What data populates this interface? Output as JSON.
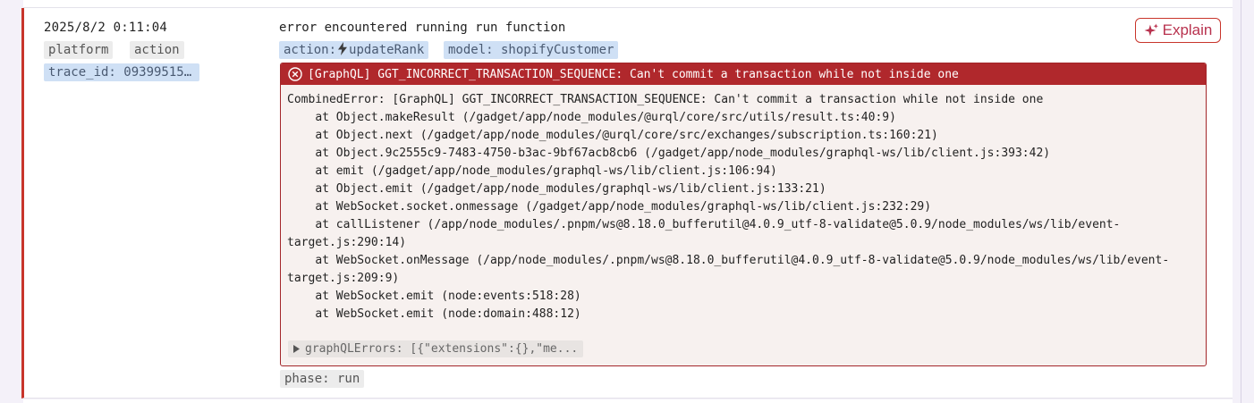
{
  "log": {
    "timestamp": "2025/8/2 0:11:04",
    "tags": [
      "platform",
      "action"
    ],
    "trace_id": "trace_id: 09399515…",
    "message": "error encountered running run function",
    "action_prefix": "action:",
    "action_name": "updateRank",
    "model": "model: shopifyCustomer",
    "explain_label": "Explain",
    "error_title": "[GraphQL] GGT_INCORRECT_TRANSACTION_SEQUENCE: Can't commit a transaction while not inside one",
    "stack": [
      "CombinedError: [GraphQL] GGT_INCORRECT_TRANSACTION_SEQUENCE: Can't commit a transaction while not inside one",
      "    at Object.makeResult (/gadget/app/node_modules/@urql/core/src/utils/result.ts:40:9)",
      "    at Object.next (/gadget/app/node_modules/@urql/core/src/exchanges/subscription.ts:160:21)",
      "    at Object.9c2555c9-7483-4750-b3ac-9bf67acb8cb6 (/gadget/app/node_modules/graphql-ws/lib/client.js:393:42)",
      "    at emit (/gadget/app/node_modules/graphql-ws/lib/client.js:106:94)",
      "    at Object.emit (/gadget/app/node_modules/graphql-ws/lib/client.js:133:21)",
      "    at WebSocket.socket.onmessage (/gadget/app/node_modules/graphql-ws/lib/client.js:232:29)",
      "    at callListener (/app/node_modules/.pnpm/ws@8.18.0_bufferutil@4.0.9_utf-8-validate@5.0.9/node_modules/ws/lib/event-",
      "target.js:290:14)",
      "    at WebSocket.onMessage (/app/node_modules/.pnpm/ws@8.18.0_bufferutil@4.0.9_utf-8-validate@5.0.9/node_modules/ws/lib/event-",
      "target.js:209:9)",
      "    at WebSocket.emit (node:events:518:28)",
      "    at WebSocket.emit (node:domain:488:12)"
    ],
    "graphql_errors": "graphQLErrors: [{\"extensions\":{},\"me...",
    "phase": "phase: run"
  },
  "colors": {
    "error_red": "#b0282c",
    "accent_pink": "#b8324e",
    "tag_blue": "#cfe0f5",
    "tag_gray": "#ececec"
  },
  "icons": {
    "explain": "sparkle-icon",
    "error": "error-circle-icon",
    "action": "bolt-icon",
    "expand": "caret-right-icon"
  }
}
